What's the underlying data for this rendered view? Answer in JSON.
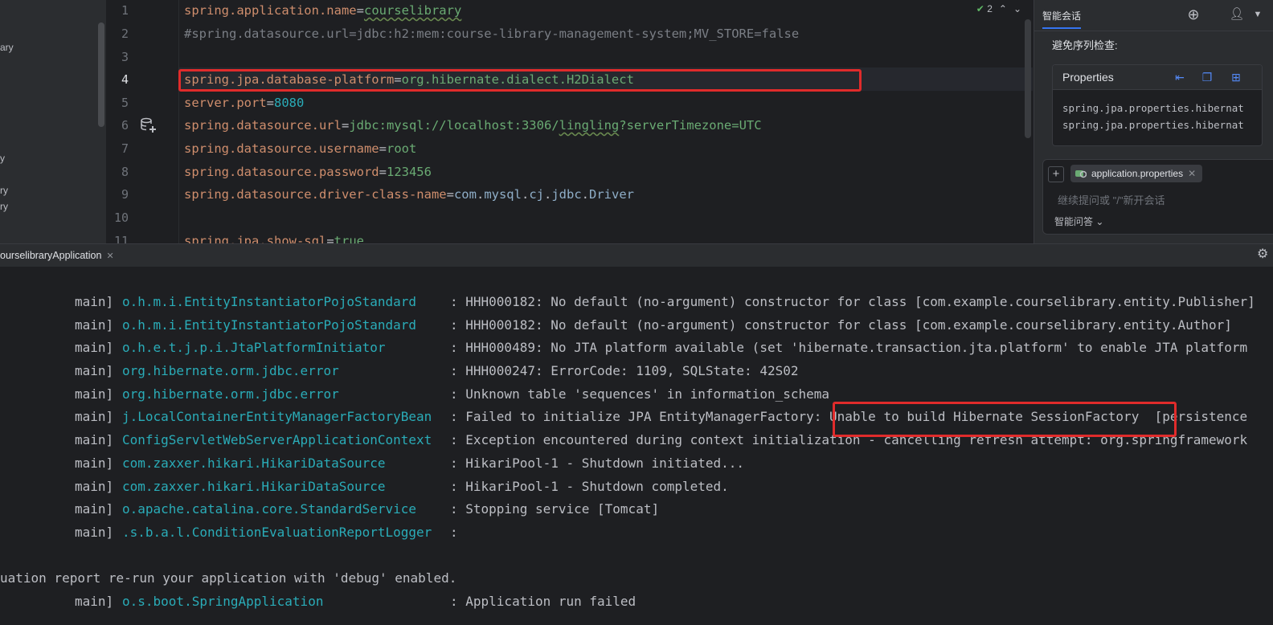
{
  "project": {
    "tree_fragments": [
      "ary",
      "y",
      "ry",
      "ry"
    ]
  },
  "editor": {
    "inspection_count": "2",
    "line_numbers": [
      "1",
      "2",
      "3",
      "4",
      "5",
      "6",
      "7",
      "8",
      "9",
      "10",
      "11"
    ],
    "lines": {
      "l1": {
        "key": "spring.application.name",
        "eq": "=",
        "val": "courselibrary"
      },
      "l2": {
        "comment": "#spring.datasource.url=jdbc:h2:mem:course-library-management-system;MV_STORE=false"
      },
      "l4": {
        "key": "spring.jpa.database-platform",
        "eq": "=",
        "val": "org.hibernate.dialect.H2Dialect"
      },
      "l5": {
        "key": "server.port",
        "eq": "=",
        "val": "8080"
      },
      "l6": {
        "key": "spring.datasource.url",
        "eq": "=",
        "val_a": "jdbc:mysql://localhost:3306/",
        "val_b": "lingling",
        "val_c": "?serverTimezone=UTC"
      },
      "l7": {
        "key": "spring.datasource.username",
        "eq": "=",
        "val": "root"
      },
      "l8": {
        "key": "spring.datasource.password",
        "eq": "=",
        "val": "123456"
      },
      "l9": {
        "key": "spring.datasource.driver-class-name",
        "eq": "=",
        "p1": "com",
        "d1": ".",
        "p2": "mysql",
        "d2": ".",
        "p3": "cj",
        "d3": ".",
        "p4": "jdbc",
        "d4": ".",
        "p5": "Driver"
      },
      "l11": {
        "key": "spring.jpa.show-sql",
        "eq": "=",
        "val": "true"
      }
    }
  },
  "ai_panel": {
    "title": "智能会话",
    "message": "避免序列检查:",
    "code_card": {
      "title": "Properties",
      "lines": [
        "spring.jpa.properties.hibernat",
        "spring.jpa.properties.hibernat"
      ]
    },
    "file_chip": "application.properties",
    "input_placeholder": "继续提问或 \"/\"新开会话",
    "mode_label": "智能问答"
  },
  "run": {
    "tab_label": "ourselibraryApplication",
    "console_lines": [
      {
        "thread": "main]",
        "logger": "o.h.m.i.EntityInstantiatorPojoStandard",
        "msg": ": HHH000182: No default (no-argument) constructor for class [com.example.courselibrary.entity.Publisher]"
      },
      {
        "thread": "main]",
        "logger": "o.h.m.i.EntityInstantiatorPojoStandard",
        "msg": ": HHH000182: No default (no-argument) constructor for class [com.example.courselibrary.entity.Author]"
      },
      {
        "thread": "main]",
        "logger": "o.h.e.t.j.p.i.JtaPlatformInitiator",
        "msg": ": HHH000489: No JTA platform available (set 'hibernate.transaction.jta.platform' to enable JTA platform"
      },
      {
        "thread": "main]",
        "logger": "org.hibernate.orm.jdbc.error",
        "msg": ": HHH000247: ErrorCode: 1109, SQLState: 42S02"
      },
      {
        "thread": "main]",
        "logger": "org.hibernate.orm.jdbc.error",
        "msg": ": Unknown table 'sequences' in information_schema"
      },
      {
        "thread": "main]",
        "logger": "j.LocalContainerEntityManagerFactoryBean",
        "msg": ": Failed to initialize JPA EntityManagerFactory: Unable to build Hibernate SessionFactory  [persistence"
      },
      {
        "thread": "main]",
        "logger": "ConfigServletWebServerApplicationContext",
        "msg": ": Exception encountered during context initialization - cancelling refresh attempt: org.springframework"
      },
      {
        "thread": "main]",
        "logger": "com.zaxxer.hikari.HikariDataSource",
        "msg": ": HikariPool-1 - Shutdown initiated..."
      },
      {
        "thread": "main]",
        "logger": "com.zaxxer.hikari.HikariDataSource",
        "msg": ": HikariPool-1 - Shutdown completed."
      },
      {
        "thread": "main]",
        "logger": "o.apache.catalina.core.StandardService",
        "msg": ": Stopping service [Tomcat]"
      },
      {
        "thread": "main]",
        "logger": ".s.b.a.l.ConditionEvaluationReportLogger",
        "msg": ":"
      },
      {
        "thread": "",
        "logger": "",
        "msg": ""
      },
      {
        "wrap": "uation report re-run your application with 'debug' enabled."
      },
      {
        "thread": "main]",
        "logger": "o.s.boot.SpringApplication",
        "msg": ": Application run failed"
      }
    ]
  },
  "colors": {
    "highlight_box": "#e02b2b",
    "accent": "#3574f0",
    "logger": "#2aacb8",
    "key": "#cf8e6d",
    "value": "#6aab73"
  }
}
